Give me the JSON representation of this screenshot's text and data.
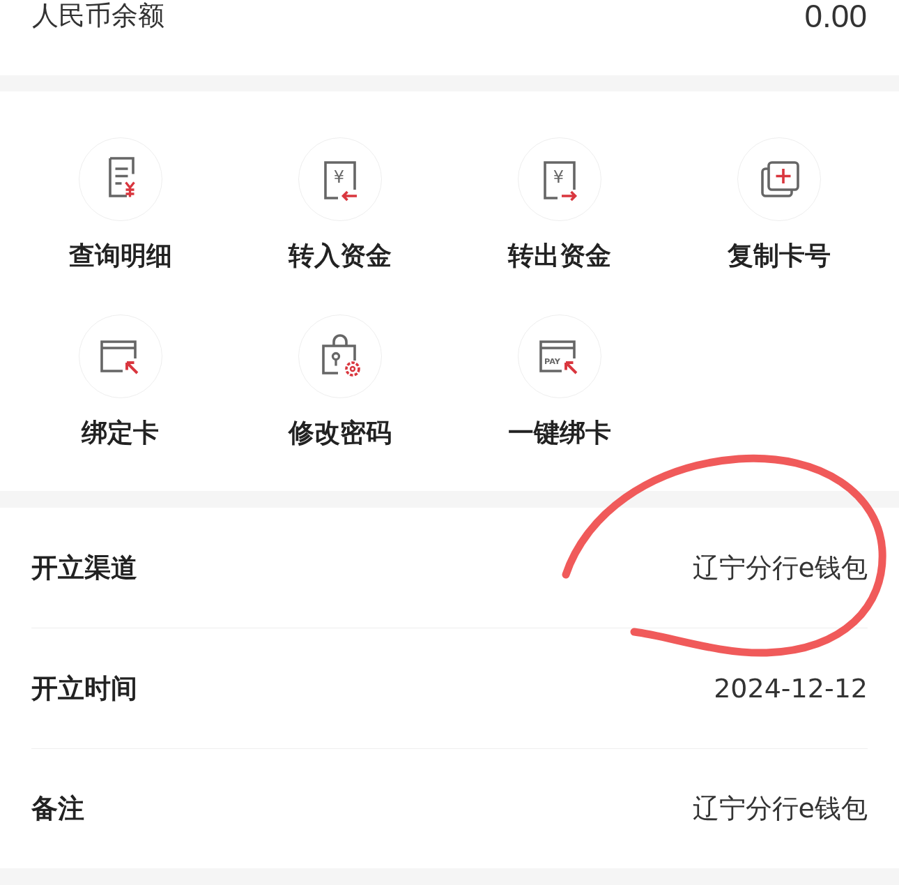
{
  "balance": {
    "label": "人民币余额",
    "amount": "0.00"
  },
  "actions": [
    {
      "label": "查询明细",
      "kind": "statement"
    },
    {
      "label": "转入资金",
      "kind": "transfer-in",
      "icon_text": "¥"
    },
    {
      "label": "转出资金",
      "kind": "transfer-out",
      "icon_text": "¥"
    },
    {
      "label": "复制卡号",
      "kind": "copy"
    },
    {
      "label": "绑定卡",
      "kind": "bind-card"
    },
    {
      "label": "修改密码",
      "kind": "lock"
    },
    {
      "label": "一键绑卡",
      "kind": "pay-card",
      "icon_text": "PAY"
    }
  ],
  "details": [
    {
      "label": "开立渠道",
      "value": "辽宁分行e钱包"
    },
    {
      "label": "开立时间",
      "value": "2024-12-12"
    },
    {
      "label": "备注",
      "value": "辽宁分行e钱包"
    }
  ],
  "annotations": [
    {
      "kind": "circle",
      "color": "#f05a5a"
    }
  ]
}
